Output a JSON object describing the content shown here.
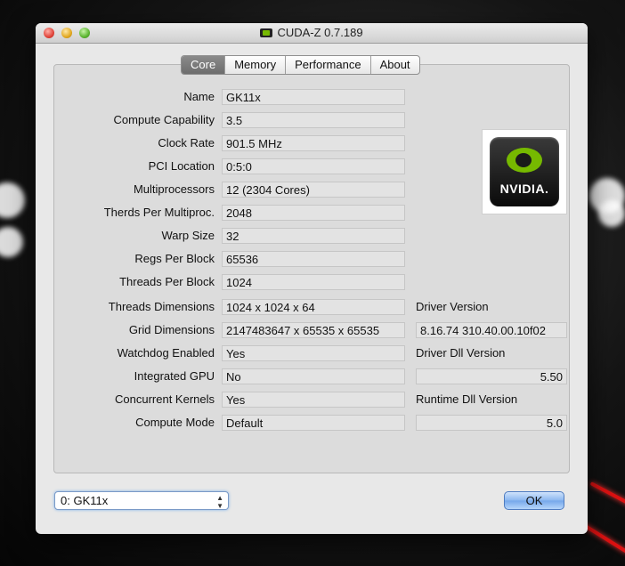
{
  "window": {
    "title": "CUDA-Z 0.7.189"
  },
  "tabs": [
    {
      "label": "Core"
    },
    {
      "label": "Memory"
    },
    {
      "label": "Performance"
    },
    {
      "label": "About"
    }
  ],
  "core": {
    "rows": [
      {
        "label": "Name",
        "value": "GK11x"
      },
      {
        "label": "Compute Capability",
        "value": "3.5"
      },
      {
        "label": "Clock Rate",
        "value": "901.5 MHz"
      },
      {
        "label": "PCI Location",
        "value": "0:5:0"
      },
      {
        "label": "Multiprocessors",
        "value": "12 (2304 Cores)"
      },
      {
        "label": "Therds Per Multiproc.",
        "value": "2048"
      },
      {
        "label": "Warp Size",
        "value": "32"
      },
      {
        "label": "Regs Per Block",
        "value": "65536"
      },
      {
        "label": "Threads Per Block",
        "value": "1024"
      },
      {
        "label": "Threads Dimensions",
        "value": "1024 x 1024 x 64"
      },
      {
        "label": "Grid Dimensions",
        "value": "2147483647 x 65535 x 65535"
      },
      {
        "label": "Watchdog Enabled",
        "value": "Yes"
      },
      {
        "label": "Integrated GPU",
        "value": "No"
      },
      {
        "label": "Concurrent Kernels",
        "value": "Yes"
      },
      {
        "label": "Compute Mode",
        "value": "Default"
      }
    ],
    "driver_version_label": "Driver Version",
    "driver_version": "8.16.74 310.40.00.10f02",
    "driver_dll_label": "Driver Dll Version",
    "driver_dll": "5.50",
    "runtime_dll_label": "Runtime Dll Version",
    "runtime_dll": "5.0",
    "logo_text": "NVIDIA."
  },
  "device_select": {
    "selected": "0: GK11x"
  },
  "ok_label": "OK",
  "colors": {
    "nvidia_green": "#76b900",
    "active_tab": "#7a7a7a",
    "ok_button": "#8ab6ef"
  }
}
